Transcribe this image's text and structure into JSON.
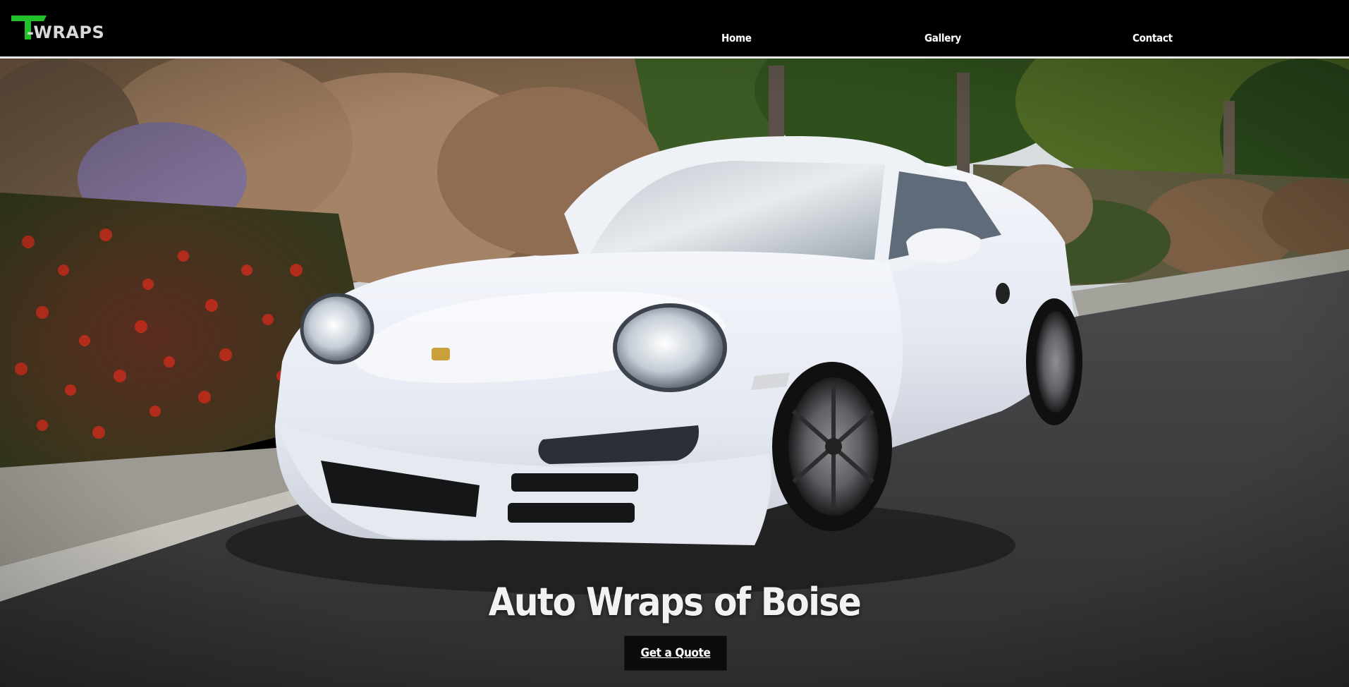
{
  "header": {
    "logo": {
      "text_prefix": "T",
      "text_rest": "-WRAPS",
      "accent_color": "#22c02a",
      "text_color": "#d9d9d9",
      "icon": "t-wraps-logo"
    },
    "nav": [
      {
        "label": "Home"
      },
      {
        "label": "Gallery"
      },
      {
        "label": "Contact"
      }
    ],
    "background_color": "#000000"
  },
  "hero": {
    "background_image": "white-porsche-911-parked-on-street",
    "title": "Auto Wraps of Boise",
    "cta_label": "Get a Quote"
  }
}
